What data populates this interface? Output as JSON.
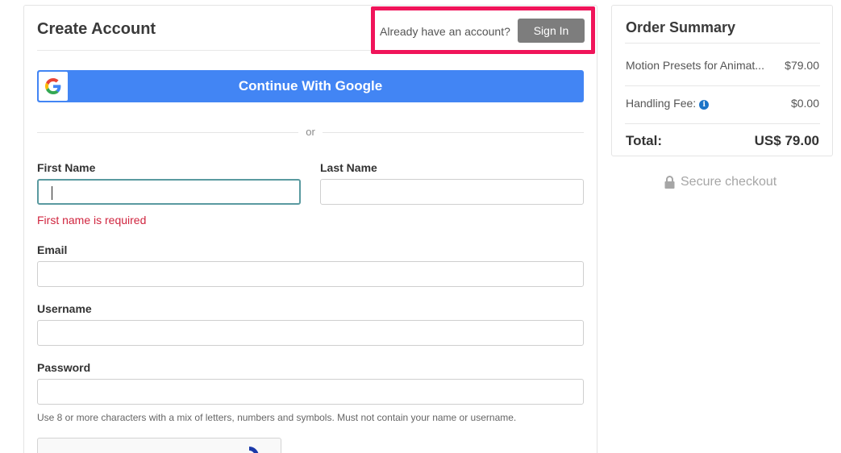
{
  "form": {
    "title": "Create Account",
    "already_text": "Already have an account?",
    "sign_in_label": "Sign In",
    "google_label": "Continue With Google",
    "divider_text": "or",
    "first_name": {
      "label": "First Name",
      "value": "",
      "error": "First name is required"
    },
    "last_name": {
      "label": "Last Name",
      "value": ""
    },
    "email": {
      "label": "Email",
      "value": ""
    },
    "username": {
      "label": "Username",
      "value": ""
    },
    "password": {
      "label": "Password",
      "value": "",
      "hint": "Use 8 or more characters with a mix of letters, numbers and symbols. Must not contain your name or username."
    }
  },
  "summary": {
    "title": "Order Summary",
    "item_name": "Motion Presets for Animat...",
    "item_price": "$79.00",
    "fee_label": "Handling Fee:",
    "fee_value": "$0.00",
    "total_label": "Total:",
    "total_value": "US$ 79.00"
  },
  "secure_text": "Secure checkout",
  "icons": {
    "google": "google-g-icon",
    "info": "info-icon",
    "lock": "lock-icon",
    "recaptcha": "recaptcha-icon"
  },
  "colors": {
    "google_blue": "#4285f4",
    "highlight": "#f0145a",
    "signin_gray": "#7d7d7d",
    "error_red": "#d0253f",
    "focus_border": "#5a9aa0"
  }
}
